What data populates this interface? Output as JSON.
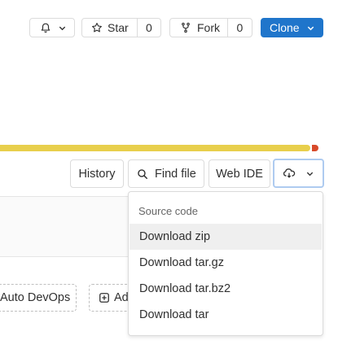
{
  "header": {
    "notification_icon": "bell-icon",
    "star": {
      "label": "Star",
      "count": "0",
      "icon": "star-icon"
    },
    "fork": {
      "label": "Fork",
      "count": "0",
      "icon": "fork-icon"
    },
    "clone": {
      "label": "Clone",
      "icon": "chevron-down-icon"
    }
  },
  "pipeline_bar": {
    "passed_fraction": 0.98,
    "color": "#e8cf4c",
    "failed_color": "#d84a2a"
  },
  "toolbar": {
    "history_label": "History",
    "find_file_label": "Find file",
    "web_ide_label": "Web IDE",
    "download_icon": "cloud-download-icon"
  },
  "actions": {
    "auto_devops_label": "Auto DevOps",
    "add_label": "Ad"
  },
  "download_menu": {
    "header": "Source code",
    "items": [
      "Download zip",
      "Download tar.gz",
      "Download tar.bz2",
      "Download tar"
    ]
  },
  "colors": {
    "accent": "#1f75cb",
    "focus_ring": "#aecbf0"
  }
}
